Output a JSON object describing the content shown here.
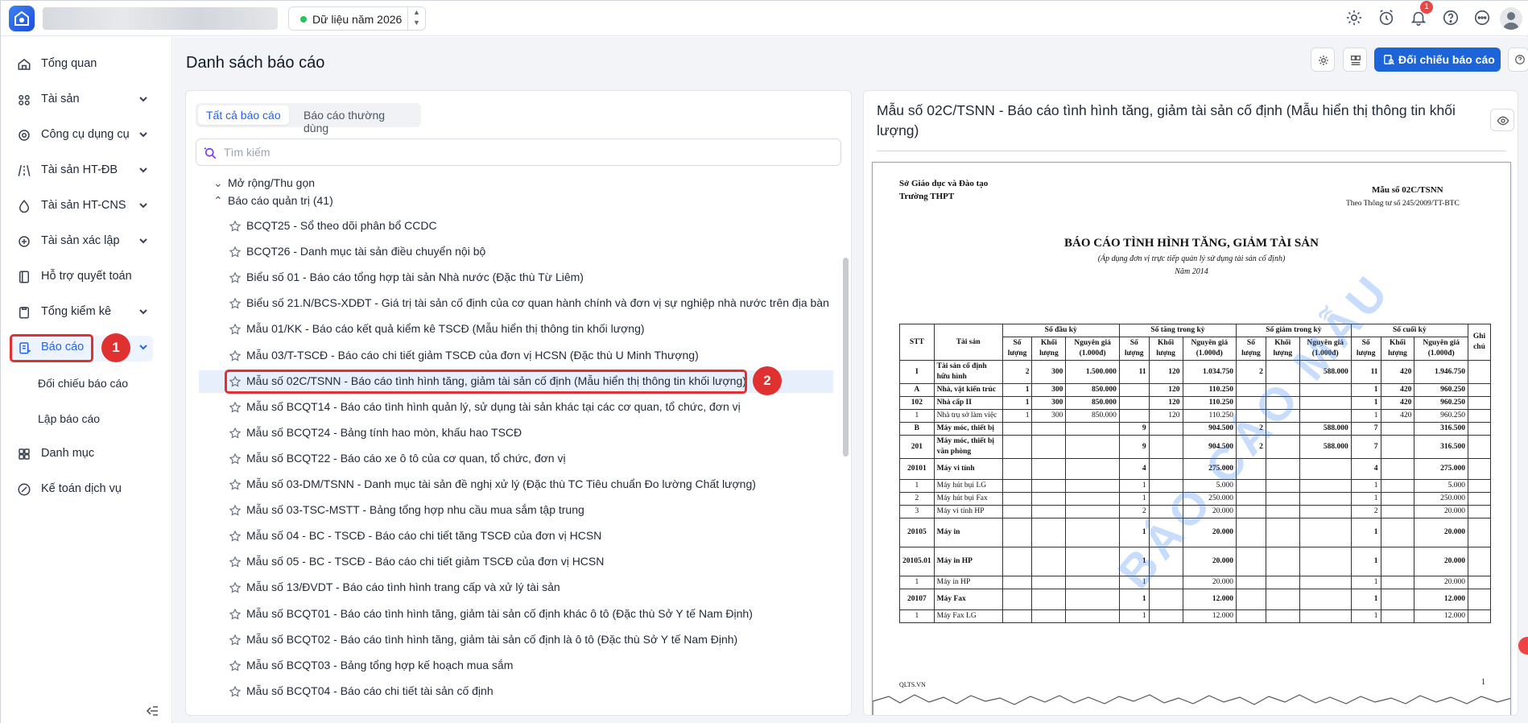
{
  "topbar": {
    "year_label": "Dữ liệu năm 2026",
    "notification_count": "1"
  },
  "sidebar": {
    "items": [
      {
        "label": "Tổng quan",
        "icon": "home-icon"
      },
      {
        "label": "Tài sản",
        "icon": "assets-icon"
      },
      {
        "label": "Công cụ dụng cụ",
        "icon": "tools-icon"
      },
      {
        "label": "Tài sản HT-ĐB",
        "icon": "road-icon"
      },
      {
        "label": "Tài sản HT-CNS",
        "icon": "water-drop-icon"
      },
      {
        "label": "Tài sản xác lập",
        "icon": "asset-establish-icon"
      },
      {
        "label": "Hỗ trợ quyết toán",
        "icon": "book-icon"
      },
      {
        "label": "Tổng kiểm kê",
        "icon": "clipboard-icon"
      },
      {
        "label": "Báo cáo",
        "icon": "report-icon"
      }
    ],
    "sub_items": [
      "Đối chiếu báo cáo",
      "Lập báo cáo"
    ],
    "items_after": [
      {
        "label": "Danh mục",
        "icon": "grid-icon"
      },
      {
        "label": "Kế toán dịch vụ",
        "icon": "accounting-icon"
      }
    ]
  },
  "annotations": {
    "step1": "1",
    "step2": "2"
  },
  "page": {
    "title": "Danh sách báo cáo",
    "compare_button": "Đối chiếu báo cáo"
  },
  "list": {
    "tabs": [
      "Tất cả báo cáo",
      "Báo cáo thường dùng"
    ],
    "search_placeholder": "Tìm kiếm",
    "expand_label": "Mở rộng/Thu gọn",
    "group_label": "Báo cáo quản trị (41)",
    "reports": [
      "BCQT25 - Sổ theo dõi phân bổ CCDC",
      "BCQT26 - Danh mục tài sản điều chuyển nội bộ",
      "Biểu số 01 - Báo cáo tổng hợp tài sản Nhà nước (Đặc thù Từ Liêm)",
      "Biểu số 21.N/BCS-XDĐT - Giá trị tài sản cố định của cơ quan hành chính và đơn vị sự nghiệp nhà nước trên địa bàn",
      "Mẫu 01/KK - Báo cáo kết quả kiểm kê TSCĐ (Mẫu hiển thị thông tin khối lượng)",
      "Mẫu 03/T-TSCĐ - Báo cáo chi tiết giảm TSCĐ của đơn vị HCSN (Đặc thù U Minh Thượng)",
      "Mẫu số 02C/TSNN - Báo cáo tình hình tăng, giảm tài sản cố định (Mẫu hiển thị thông tin khối lượng)",
      "Mẫu số BCQT14 - Báo cáo tình hình quản lý, sử dụng tài sản khác tại các cơ quan, tổ chức, đơn vị",
      "Mẫu số BCQT24 - Bảng tính hao mòn, khấu hao TSCĐ",
      "Mẫu số BCQT22 - Báo cáo xe ô tô của cơ quan, tổ chức, đơn vị",
      "Mẫu số 03-DM/TSNN - Danh mục tài sản đề nghị xử lý (Đặc thù TC Tiêu chuẩn Đo lường Chất lượng)",
      "Mẫu số 03-TSC-MSTT - Bảng tổng hợp nhu cầu mua sắm tập trung",
      "Mẫu số 04 - BC - TSCĐ - Báo cáo chi tiết tăng TSCĐ của đơn vị HCSN",
      "Mẫu số 05 - BC - TSCĐ - Báo cáo chi tiết giảm TSCĐ của đơn vị HCSN",
      "Mẫu số 13/ĐVDT - Báo cáo tình hình trang cấp và xử lý tài sản",
      "Mẫu số BCQT01 - Báo cáo tình hình tăng, giảm tài sản cố định khác ô tô (Đặc thù Sở Y tế Nam Định)",
      "Mẫu số BCQT02 - Báo cáo tình hình tăng, giảm tài sản cố định là ô tô (Đặc thù Sở Y tế Nam Định)",
      "Mẫu số BCQT03 - Bảng tổng hợp kế hoạch mua sắm",
      "Mẫu số BCQT04 - Báo cáo chi tiết tài sản cố định"
    ]
  },
  "preview": {
    "title": "Mẫu số 02C/TSNN - Báo cáo tình hình tăng, giảm tài sản cố định (Mẫu hiển thị thông tin khối lượng)",
    "doc": {
      "org1": "Sở Giáo dục và Đào tạo",
      "org2": "Trường THPT",
      "form_no": "Mẫu số 02C/TSNN",
      "circular": "Theo Thông tư số 245/2009/TT-BTC",
      "title": "BÁO CÁO TÌNH HÌNH TĂNG, GIẢM TÀI SẢN",
      "subtitle": "(Áp dụng đơn vị trực tiếp quản lý sử dụng tài sản cố định)",
      "year": "Năm 2014",
      "watermark": "BÁO CÁO MẪU",
      "footer_left": "QLTS.VN",
      "page_no": "1",
      "headers": {
        "stt": "STT",
        "asset": "Tài sản",
        "g1": "Số đầu kỳ",
        "g2": "Số tăng trong kỳ",
        "g3": "Số giảm trong kỳ",
        "g4": "Số cuối kỳ",
        "qty": "Số lượng",
        "vol": "Khối lượng",
        "cost": "Nguyên giá (1.000đ)",
        "note": "Ghi chú"
      },
      "rows": [
        {
          "stt": "I",
          "name": "Tài sản cố định hữu hình",
          "b": true,
          "v": [
            "2",
            "300",
            "1.500.000",
            "11",
            "120",
            "1.034.750",
            "2",
            "",
            "588.000",
            "11",
            "420",
            "1.946.750"
          ]
        },
        {
          "stt": "A",
          "name": "Nhà, vật kiến trúc",
          "b": true,
          "v": [
            "1",
            "300",
            "850.000",
            "",
            "120",
            "110.250",
            "",
            "",
            "",
            "1",
            "420",
            "960.250"
          ]
        },
        {
          "stt": "102",
          "name": "Nhà cấp II",
          "b": true,
          "v": [
            "1",
            "300",
            "850.000",
            "",
            "120",
            "110.250",
            "",
            "",
            "",
            "1",
            "420",
            "960.250"
          ]
        },
        {
          "stt": "1",
          "name": "Nhà trụ sở làm việc",
          "b": false,
          "v": [
            "1",
            "300",
            "850.000",
            "",
            "120",
            "110.250",
            "",
            "",
            "",
            "1",
            "420",
            "960.250"
          ]
        },
        {
          "stt": "B",
          "name": "Máy móc, thiết bị",
          "b": true,
          "v": [
            "",
            "",
            "",
            "9",
            "",
            "904.500",
            "2",
            "",
            "588.000",
            "7",
            "",
            "316.500"
          ]
        },
        {
          "stt": "201",
          "name": "Máy móc, thiết bị văn phòng",
          "b": true,
          "v": [
            "",
            "",
            "",
            "9",
            "",
            "904.500",
            "2",
            "",
            "588.000",
            "7",
            "",
            "316.500"
          ]
        },
        {
          "stt": "20101",
          "name": "Máy vi tính",
          "b": true,
          "v": [
            "",
            "",
            "",
            "4",
            "",
            "275.000",
            "",
            "",
            "",
            "4",
            "",
            "275.000"
          ]
        },
        {
          "stt": "1",
          "name": "Máy hút bụi LG",
          "b": false,
          "v": [
            "",
            "",
            "",
            "1",
            "",
            "5.000",
            "",
            "",
            "",
            "1",
            "",
            "5.000"
          ]
        },
        {
          "stt": "2",
          "name": "Máy hút bụi Fax",
          "b": false,
          "v": [
            "",
            "",
            "",
            "1",
            "",
            "250.000",
            "",
            "",
            "",
            "1",
            "",
            "250.000"
          ]
        },
        {
          "stt": "3",
          "name": "Máy vi tính HP",
          "b": false,
          "v": [
            "",
            "",
            "",
            "2",
            "",
            "20.000",
            "",
            "",
            "",
            "2",
            "",
            "20.000"
          ]
        },
        {
          "stt": "20105",
          "name": "Máy in",
          "b": true,
          "v": [
            "",
            "",
            "",
            "1",
            "",
            "20.000",
            "",
            "",
            "",
            "1",
            "",
            "20.000"
          ]
        },
        {
          "stt": "20105.01",
          "name": "Máy in HP",
          "b": true,
          "v": [
            "",
            "",
            "",
            "1",
            "",
            "20.000",
            "",
            "",
            "",
            "1",
            "",
            "20.000"
          ]
        },
        {
          "stt": "1",
          "name": "Máy in HP",
          "b": false,
          "v": [
            "",
            "",
            "",
            "1",
            "",
            "20.000",
            "",
            "",
            "",
            "1",
            "",
            "20.000"
          ]
        },
        {
          "stt": "20107",
          "name": "Máy Fax",
          "b": true,
          "v": [
            "",
            "",
            "",
            "1",
            "",
            "12.000",
            "",
            "",
            "",
            "1",
            "",
            "12.000"
          ]
        },
        {
          "stt": "1",
          "name": "Máy Fax LG",
          "b": false,
          "v": [
            "",
            "",
            "",
            "1",
            "",
            "12.000",
            "",
            "",
            "",
            "1",
            "",
            "12.000"
          ]
        }
      ]
    }
  },
  "colors": {
    "accent": "#1d64d8",
    "annotation": "#e03131",
    "active_bg": "#eef4ff"
  }
}
